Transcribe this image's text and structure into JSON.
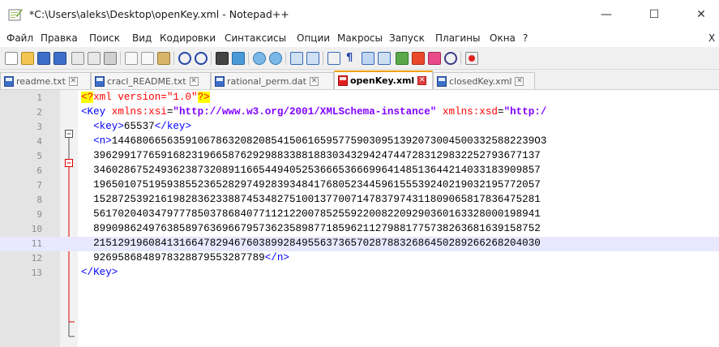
{
  "window": {
    "title": "*C:\\Users\\aleks\\Desktop\\openKey.xml - Notepad++",
    "minimize_glyph": "—",
    "maximize_glyph": "☐",
    "close_glyph": "✕"
  },
  "menu": [
    "Файл",
    "Правка",
    "Поиск",
    "Вид",
    "Кодировки",
    "Синтаксисы",
    "Опции",
    "Макросы",
    "Запуск",
    "Плагины",
    "Окна",
    "?",
    "X"
  ],
  "toolbar": {
    "icons": [
      "new-file-icon",
      "open-file-icon",
      "save-icon",
      "save-all-icon",
      "close-icon",
      "close-all-icon",
      "print-icon",
      "cut-icon",
      "copy-icon",
      "paste-icon",
      "undo-icon",
      "redo-icon",
      "find-icon",
      "replace-icon",
      "zoom-in-icon",
      "zoom-out-icon",
      "sync-vertical-icon",
      "sync-horizontal-icon",
      "word-wrap-icon",
      "show-all-chars-icon",
      "indent-guide-icon",
      "udl-icon",
      "doc-map-icon",
      "function-list-icon",
      "folder-workspace-icon",
      "monitoring-icon",
      "record-macro-icon"
    ]
  },
  "tabs": [
    {
      "label": "readme.txt",
      "active": false,
      "modified": false
    },
    {
      "label": "cracl_README.txt",
      "active": false,
      "modified": false
    },
    {
      "label": "rational_perm.dat",
      "active": false,
      "modified": false
    },
    {
      "label": "openKey.xml",
      "active": true,
      "modified": true
    },
    {
      "label": "closedKey.xml",
      "active": false,
      "modified": false
    }
  ],
  "editor": {
    "current_line": 11,
    "lines": [
      {
        "num": "1",
        "segments": [
          {
            "t": "<?",
            "c": "c-pi"
          },
          {
            "t": "xml version=\"1.0\"",
            "c": "c-attr"
          },
          {
            "t": "?>",
            "c": "c-pi"
          }
        ]
      },
      {
        "num": "2",
        "fold": "minus",
        "segments": [
          {
            "t": "<Key ",
            "c": "c-tag"
          },
          {
            "t": "xmlns:xsi",
            "c": "c-attr"
          },
          {
            "t": "=",
            "c": "c-text"
          },
          {
            "t": "\"http://www.w3.org/2001/XMLSchema-instance\"",
            "c": "c-str"
          },
          {
            "t": " xmlns:xsd",
            "c": "c-attr"
          },
          {
            "t": "=",
            "c": "c-text"
          },
          {
            "t": "\"http:/",
            "c": "c-str"
          }
        ]
      },
      {
        "num": "3",
        "segments": [
          {
            "t": "  <key>",
            "c": "c-tag"
          },
          {
            "t": "65537",
            "c": "c-text"
          },
          {
            "t": "</key>",
            "c": "c-tag"
          }
        ]
      },
      {
        "num": "4",
        "fold": "minus-red",
        "segments": [
          {
            "t": "  <n>",
            "c": "c-tag"
          },
          {
            "t": "144680665635910678632082085415061659577590309513920730045003325882239O3",
            "c": "c-text"
          }
        ]
      },
      {
        "num": "5",
        "segments": [
          {
            "t": "  3962991776591682319665876292988338818830343294247447283129832252793677137",
            "c": "c-text"
          }
        ]
      },
      {
        "num": "6",
        "segments": [
          {
            "t": "  3460286752493623873208911665449405253666536669964148513644214033183909857",
            "c": "c-text"
          }
        ]
      },
      {
        "num": "7",
        "segments": [
          {
            "t": "  1965010751959385523652829749283934841768052344596155539240219032195772057",
            "c": "c-text"
          }
        ]
      },
      {
        "num": "8",
        "segments": [
          {
            "t": "  1528725392161982836233887453482751001377007147837974311809065817836475281",
            "c": "c-text"
          }
        ]
      },
      {
        "num": "9",
        "segments": [
          {
            "t": "  5617020403479777850378684077112122007852559220082209290360163328000198941",
            "c": "c-text"
          }
        ]
      },
      {
        "num": "10",
        "segments": [
          {
            "t": "  8990986249763858976369667957362358987718596211279881775738263681639158752",
            "c": "c-text"
          }
        ]
      },
      {
        "num": "11",
        "segments": [
          {
            "t": "  2151291960841316647829467603899284955637365702878832686450289266268204030",
            "c": "c-text"
          }
        ]
      },
      {
        "num": "12",
        "segments": [
          {
            "t": "  9269586848978328879553287789",
            "c": "c-text"
          },
          {
            "t": "</n>",
            "c": "c-tag"
          }
        ]
      },
      {
        "num": "13",
        "segments": [
          {
            "t": "</Key>",
            "c": "c-tag"
          }
        ]
      }
    ]
  }
}
